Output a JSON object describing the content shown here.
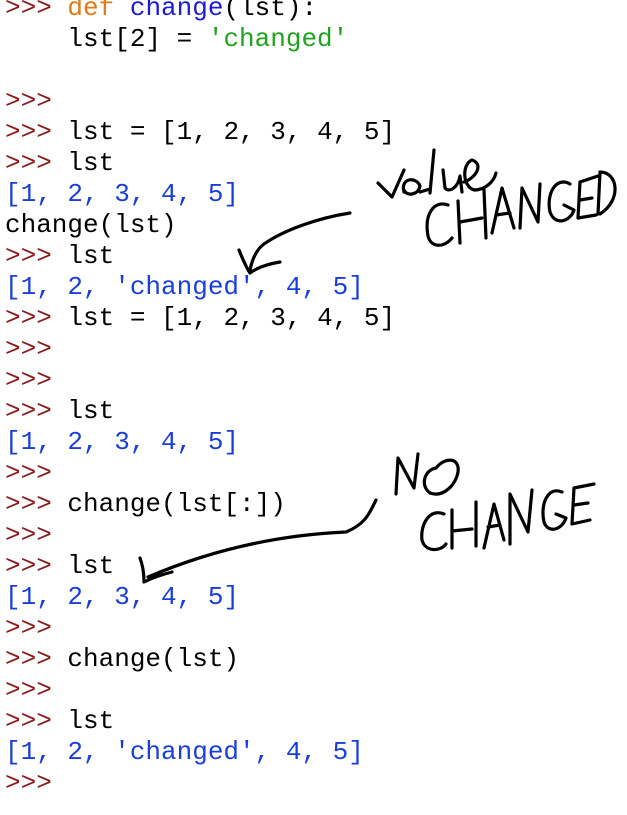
{
  "shell": {
    "prompt": ">>> ",
    "lines": [
      {
        "kind": "def",
        "prompt": ">>> ",
        "keyword": "def",
        "name": "change",
        "rest": "(lst):"
      },
      {
        "kind": "assign",
        "pre": "    lst[2] = ",
        "string": "'changed'"
      },
      {
        "kind": "blank"
      },
      {
        "kind": "input",
        "prompt": ">>>",
        "code": ""
      },
      {
        "kind": "input",
        "prompt": ">>> ",
        "code": "lst = [1, 2, 3, 4, 5]"
      },
      {
        "kind": "input",
        "prompt": ">>> ",
        "code": "lst"
      },
      {
        "kind": "output",
        "text": "[1, 2, 3, 4, 5]"
      },
      {
        "kind": "plain",
        "text": "change(lst)"
      },
      {
        "kind": "input",
        "prompt": ">>> ",
        "code": "lst"
      },
      {
        "kind": "output",
        "text": "[1, 2, 'changed', 4, 5]"
      },
      {
        "kind": "input",
        "prompt": ">>> ",
        "code": "lst = [1, 2, 3, 4, 5]"
      },
      {
        "kind": "input",
        "prompt": ">>>",
        "code": ""
      },
      {
        "kind": "input",
        "prompt": ">>>",
        "code": ""
      },
      {
        "kind": "input",
        "prompt": ">>> ",
        "code": "lst"
      },
      {
        "kind": "output",
        "text": "[1, 2, 3, 4, 5]"
      },
      {
        "kind": "input",
        "prompt": ">>>",
        "code": ""
      },
      {
        "kind": "input",
        "prompt": ">>> ",
        "code": "change(lst[:])"
      },
      {
        "kind": "input",
        "prompt": ">>>",
        "code": ""
      },
      {
        "kind": "input",
        "prompt": ">>> ",
        "code": "lst"
      },
      {
        "kind": "output",
        "text": "[1, 2, 3, 4, 5]"
      },
      {
        "kind": "input",
        "prompt": ">>>",
        "code": ""
      },
      {
        "kind": "input",
        "prompt": ">>> ",
        "code": "change(lst)"
      },
      {
        "kind": "input",
        "prompt": ">>>",
        "code": ""
      },
      {
        "kind": "input",
        "prompt": ">>> ",
        "code": "lst"
      },
      {
        "kind": "output",
        "text": "[1, 2, 'changed', 4, 5]"
      },
      {
        "kind": "input",
        "prompt": ">>>",
        "code": ""
      }
    ]
  },
  "annotations": {
    "value_changed": {
      "line1": "value",
      "line2": "CHANGED"
    },
    "no_change": {
      "line1": "NO",
      "line2": "CHANGE"
    }
  },
  "colors": {
    "prompt": "#8b1a1a",
    "keyword": "#e07a16",
    "function_name": "#1a1ad8",
    "string": "#1fa31f",
    "output": "#1a3fd8",
    "ink": "#000000",
    "background": "#ffffff"
  }
}
